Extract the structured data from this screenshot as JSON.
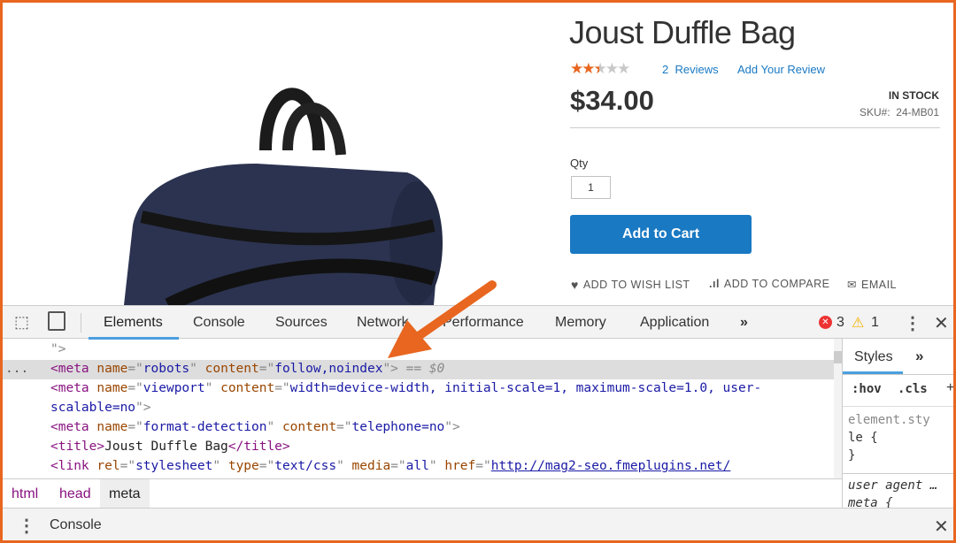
{
  "product": {
    "title": "Joust Duffle Bag",
    "rating_stars": 2.5,
    "rating_max": 5,
    "reviews_link": "2  Reviews",
    "add_review_link": "Add Your Review",
    "price": "$34.00",
    "stock": "IN STOCK",
    "sku_label": "SKU#:",
    "sku": "24-MB01",
    "qty_label": "Qty",
    "qty_value": "1",
    "add_to_cart": "Add to Cart",
    "actions": [
      "ADD TO WISH LIST",
      "ADD TO COMPARE",
      "EMAIL"
    ]
  },
  "devtools": {
    "tabs": [
      "Elements",
      "Console",
      "Sources",
      "Network",
      "Performance",
      "Memory",
      "Application"
    ],
    "more": "»",
    "errors": "3",
    "warnings": "1",
    "code": {
      "l0": "\">",
      "l1": {
        "t1": "<meta ",
        "a1": "name",
        "eq": "=\"",
        "v1": "robots",
        "q": "\" ",
        "a2": "content",
        "v2": "follow,noindex",
        "end": "\">",
        "sel": " == $0"
      },
      "l2": {
        "t1": "<meta ",
        "a1": "name",
        "v1": "viewport",
        "a2": "content",
        "v2": "width=device-width, initial-scale=1, maximum-scale=1.0, user-"
      },
      "l3": {
        "v": "scalable=no",
        "end": "\">"
      },
      "l4": {
        "t1": "<meta ",
        "a1": "name",
        "v1": "format-detection",
        "a2": "content",
        "v2": "telephone=no",
        "end": "\">"
      },
      "l5": {
        "open": "<title>",
        "text": "Joust Duffle Bag",
        "close": "</title>"
      },
      "l6": {
        "t1": "<link ",
        "a1": "rel",
        "v1": "stylesheet",
        "a2": "type",
        "v2": "text/css",
        "a3": "media",
        "v3": "all",
        "a4": "href",
        "v4": "http://mag2-seo.fmeplugins.net/"
      },
      "dots": "..."
    },
    "breadcrumbs": [
      "html",
      "head",
      "meta"
    ],
    "styles": {
      "tab": "Styles",
      "more": "»",
      "hov": ":hov",
      "cls": ".cls",
      "plus": "+",
      "rule1a": "element.sty",
      "rule1b": "le {",
      "rule1c": "}",
      "ua": "user agent …",
      "ua2": "meta {"
    },
    "drawer": "Console"
  },
  "colors": {
    "accent": "#e8661f",
    "button": "#1979c3"
  }
}
